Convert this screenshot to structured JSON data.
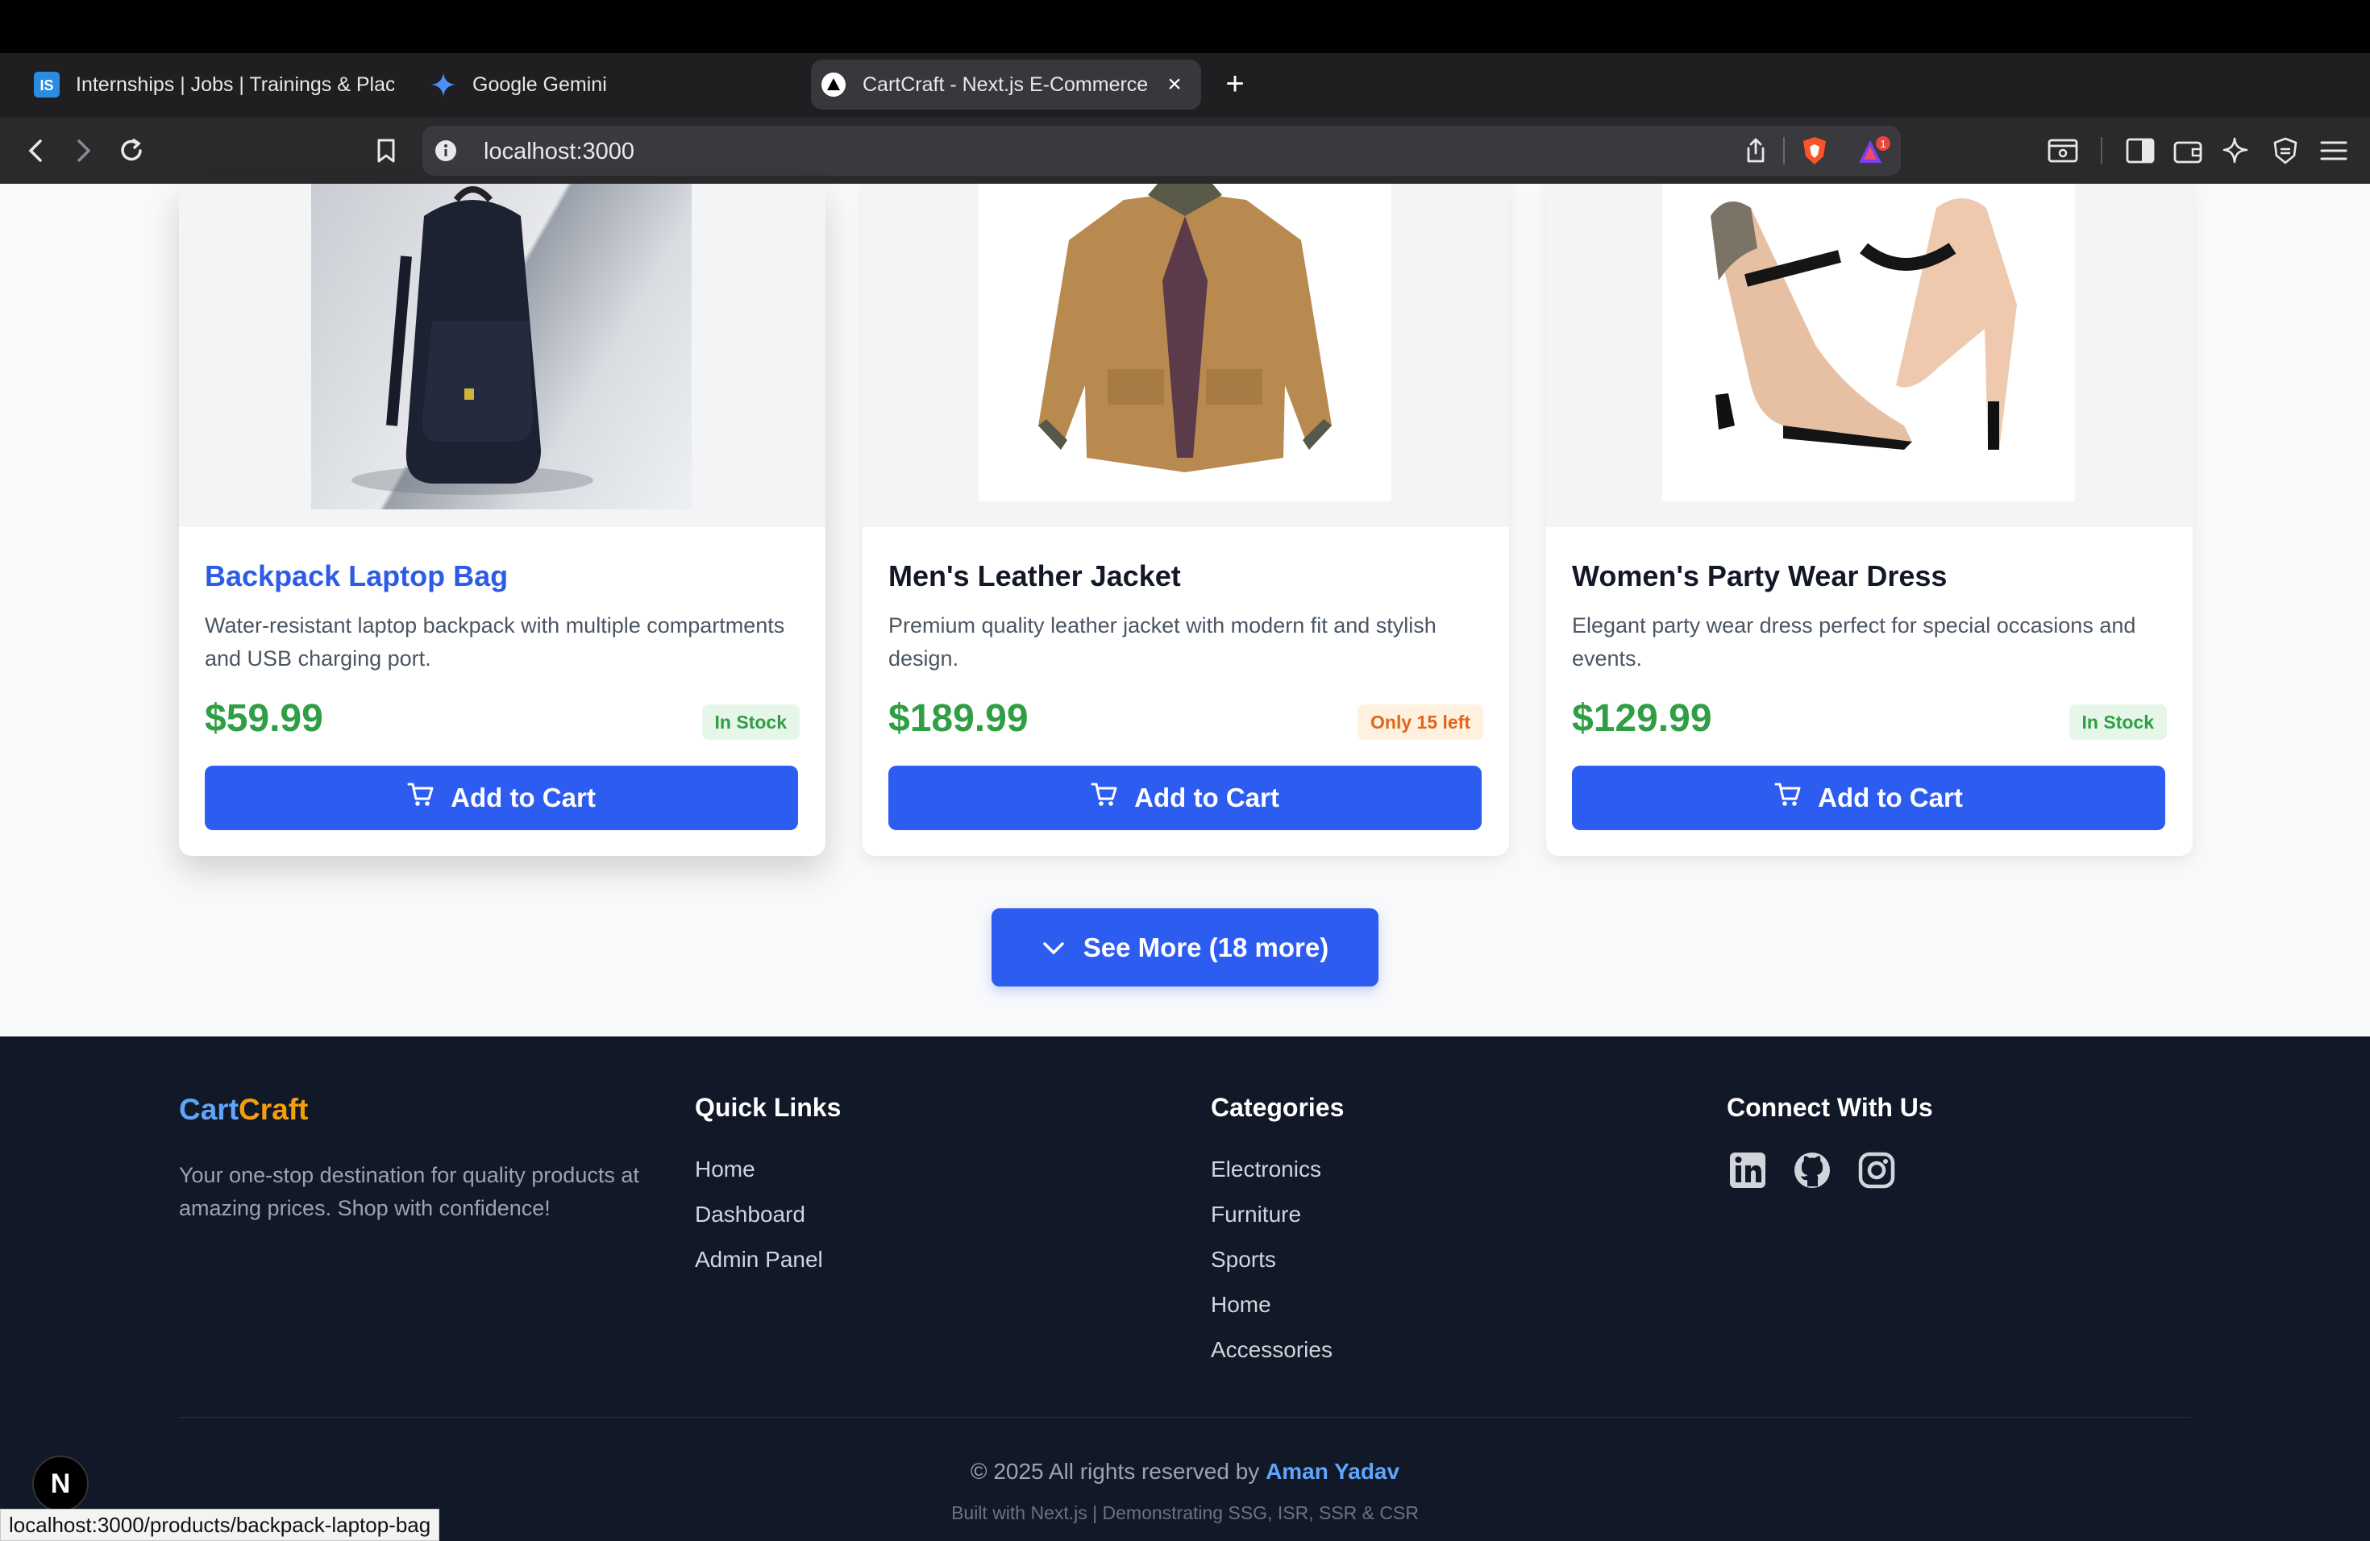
{
  "browser": {
    "tabs": [
      {
        "label": "Internships | Jobs | Trainings & Plac",
        "icon": "internshala-icon"
      },
      {
        "label": "Google Gemini",
        "icon": "gemini-icon"
      },
      {
        "label": "CartCraft - Next.js E-Commerce",
        "icon": "nextjs-icon",
        "active": true
      }
    ],
    "url": "localhost:3000",
    "status_url": "localhost:3000/products/backpack-laptop-bag",
    "brave_notification_count": "1"
  },
  "products": [
    {
      "title": "Backpack Laptop Bag",
      "description": "Water-resistant laptop backpack with multiple compartments and USB charging port.",
      "price": "$59.99",
      "stock": "In Stock",
      "stock_status": "in-stock",
      "image": "backpack"
    },
    {
      "title": "Men's Leather Jacket",
      "description": "Premium quality leather jacket with modern fit and stylish design.",
      "price": "$189.99",
      "stock": "Only 15 left",
      "stock_status": "low-stock",
      "image": "jacket"
    },
    {
      "title": "Women's Party Wear Dress",
      "description": "Elegant party wear dress perfect for special occasions and events.",
      "price": "$129.99",
      "stock": "In Stock",
      "stock_status": "in-stock",
      "image": "heels"
    }
  ],
  "add_to_cart_label": "Add to Cart",
  "see_more_label": "See More (18 more)",
  "footer": {
    "brand_part1": "Cart",
    "brand_part2": "Craft",
    "tagline": "Your one-stop destination for quality products at amazing prices. Shop with confidence!",
    "quick_links_title": "Quick Links",
    "quick_links": [
      "Home",
      "Dashboard",
      "Admin Panel"
    ],
    "categories_title": "Categories",
    "categories": [
      "Electronics",
      "Furniture",
      "Sports",
      "Home",
      "Accessories"
    ],
    "connect_title": "Connect With Us",
    "social": [
      "linkedin-icon",
      "github-icon",
      "instagram-icon"
    ],
    "copyright_prefix": "© 2025 All rights reserved by",
    "author": "Aman Yadav",
    "built_with": "Built with Next.js | Demonstrating SSG, ISR, SSR & CSR"
  },
  "nextjs_badge": "N",
  "colors": {
    "accent": "#2d5cf0",
    "price": "#2f9e44",
    "footer_bg": "#111827",
    "brand_blue": "#60a5fa",
    "brand_orange": "#f59e0b"
  }
}
